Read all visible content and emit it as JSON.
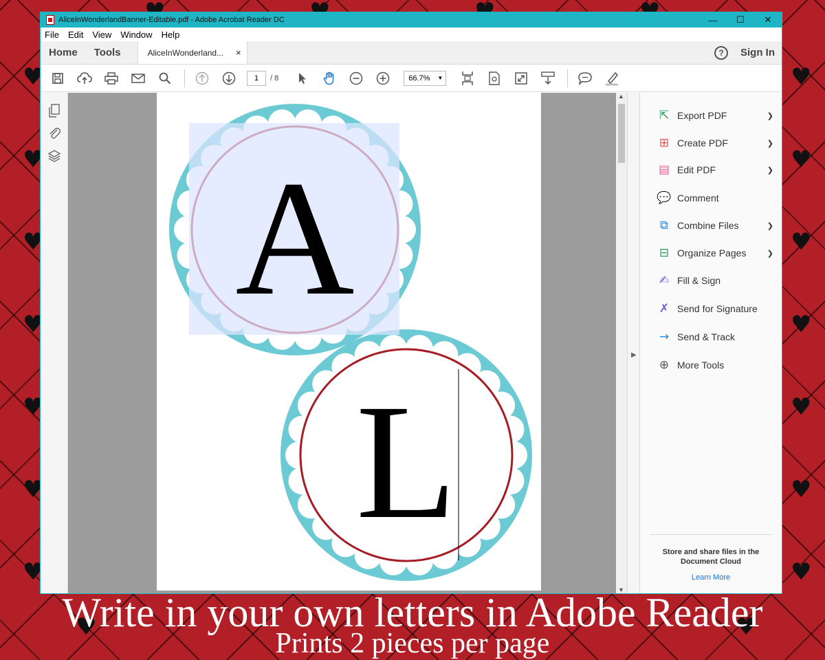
{
  "window": {
    "title": "AliceInWonderlandBanner-Editable.pdf - Adobe Acrobat Reader DC",
    "minimize": "—",
    "maximize": "☐",
    "close": "✕"
  },
  "menu": [
    "File",
    "Edit",
    "View",
    "Window",
    "Help"
  ],
  "tabs": {
    "home": "Home",
    "tools": "Tools",
    "document": "AliceInWonderland...",
    "close": "×",
    "help": "?",
    "signin": "Sign In"
  },
  "toolbar": {
    "page_current": "1",
    "page_total": "/ 8",
    "zoom": "66.7%"
  },
  "document": {
    "letter1": "A",
    "letter2": "L",
    "colors": {
      "scallop": "#6ccad4",
      "ring_red": "#a61c24",
      "selection": "#dce4ff"
    }
  },
  "tools_panel": {
    "items": [
      {
        "label": "Export PDF",
        "icon": "export-pdf-icon",
        "chevron": true
      },
      {
        "label": "Create PDF",
        "icon": "create-pdf-icon",
        "chevron": true
      },
      {
        "label": "Edit PDF",
        "icon": "edit-pdf-icon",
        "chevron": true
      },
      {
        "label": "Comment",
        "icon": "comment-icon",
        "chevron": false
      },
      {
        "label": "Combine Files",
        "icon": "combine-files-icon",
        "chevron": true
      },
      {
        "label": "Organize Pages",
        "icon": "organize-pages-icon",
        "chevron": true
      },
      {
        "label": "Fill & Sign",
        "icon": "fill-sign-icon",
        "chevron": false
      },
      {
        "label": "Send for Signature",
        "icon": "send-signature-icon",
        "chevron": false
      },
      {
        "label": "Send & Track",
        "icon": "send-track-icon",
        "chevron": false
      },
      {
        "label": "More Tools",
        "icon": "more-tools-icon",
        "chevron": false
      }
    ],
    "cloud_text": "Store and share files in the Document Cloud",
    "learn_more": "Learn More"
  },
  "caption": {
    "headline": "Write in your own letters in Adobe Reader",
    "subline": "Prints 2 pieces per page"
  }
}
